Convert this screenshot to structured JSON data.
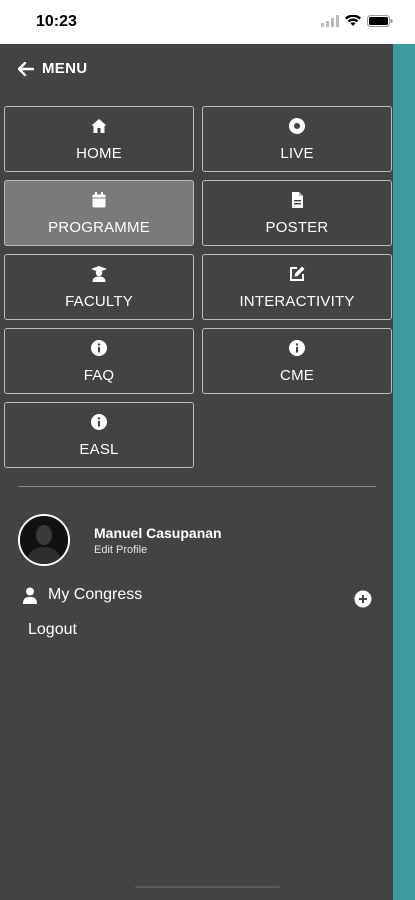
{
  "status": {
    "time": "10:23"
  },
  "menu": {
    "title": "MENU"
  },
  "tiles": [
    {
      "label": "HOME",
      "icon": "home-icon"
    },
    {
      "label": "LIVE",
      "icon": "live-icon"
    },
    {
      "label": "PROGRAMME",
      "icon": "calendar-icon",
      "active": true
    },
    {
      "label": "POSTER",
      "icon": "document-icon"
    },
    {
      "label": "FACULTY",
      "icon": "faculty-icon"
    },
    {
      "label": "INTERACTIVITY",
      "icon": "edit-icon"
    },
    {
      "label": "FAQ",
      "icon": "info-icon"
    },
    {
      "label": "CME",
      "icon": "info-icon"
    },
    {
      "label": "EASL",
      "icon": "info-icon"
    }
  ],
  "profile": {
    "name": "Manuel Casupanan",
    "edit_label": "Edit Profile"
  },
  "links": {
    "my_congress": "My Congress",
    "logout": "Logout"
  },
  "colors": {
    "drawer_bg": "#434343",
    "active_tile": "#7a7a7a",
    "accent_strip": "#3f9aa0"
  }
}
